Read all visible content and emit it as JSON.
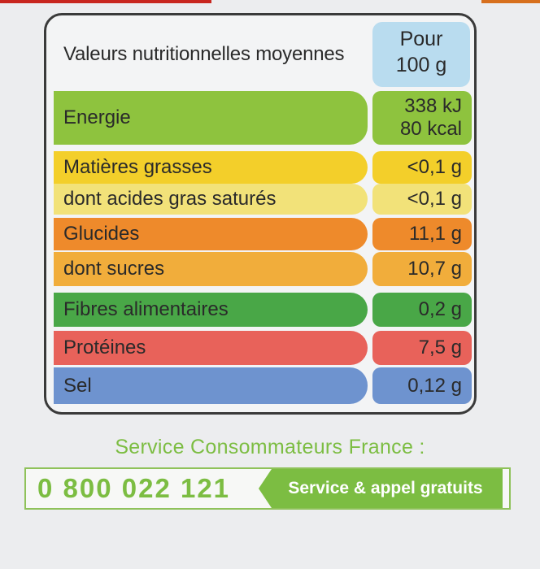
{
  "header": {
    "title": "Valeurs nutritionnelles moyennes",
    "per_line1": "Pour",
    "per_line2": "100 g"
  },
  "rows": [
    {
      "label": "Energie",
      "value1": "338 kJ",
      "value2": "80 kcal",
      "label_color": "#8ec33e",
      "value_color": "#8ec33e"
    },
    {
      "label": "Matières grasses",
      "value1": "<0,1 g",
      "value2": "",
      "label_color": "#f3cf2a",
      "value_color": "#f3cf2a"
    },
    {
      "label": "dont acides gras saturés",
      "value1": "<0,1 g",
      "value2": "",
      "label_color": "#f2e279",
      "value_color": "#f2e279"
    },
    {
      "label": "Glucides",
      "value1": "11,1 g",
      "value2": "",
      "label_color": "#ee8a2b",
      "value_color": "#ee8a2b"
    },
    {
      "label": "dont sucres",
      "value1": "10,7 g",
      "value2": "",
      "label_color": "#f1ad3b",
      "value_color": "#f1ad3b"
    },
    {
      "label": "Fibres alimentaires",
      "value1": "0,2 g",
      "value2": "",
      "label_color": "#49a747",
      "value_color": "#49a747"
    },
    {
      "label": "Protéines",
      "value1": "7,5 g",
      "value2": "",
      "label_color": "#e8625a",
      "value_color": "#e8625a"
    },
    {
      "label": "Sel",
      "value1": "0,12 g",
      "value2": "",
      "label_color": "#6e93cf",
      "value_color": "#6e93cf"
    }
  ],
  "footer": {
    "service_title": "Service Consommateurs France :",
    "phone": "0 800 022 121",
    "tag": "Service & appel gratuits"
  },
  "colors": {
    "accent_green": "#7cbd42",
    "per_box": "#b9dcef"
  }
}
